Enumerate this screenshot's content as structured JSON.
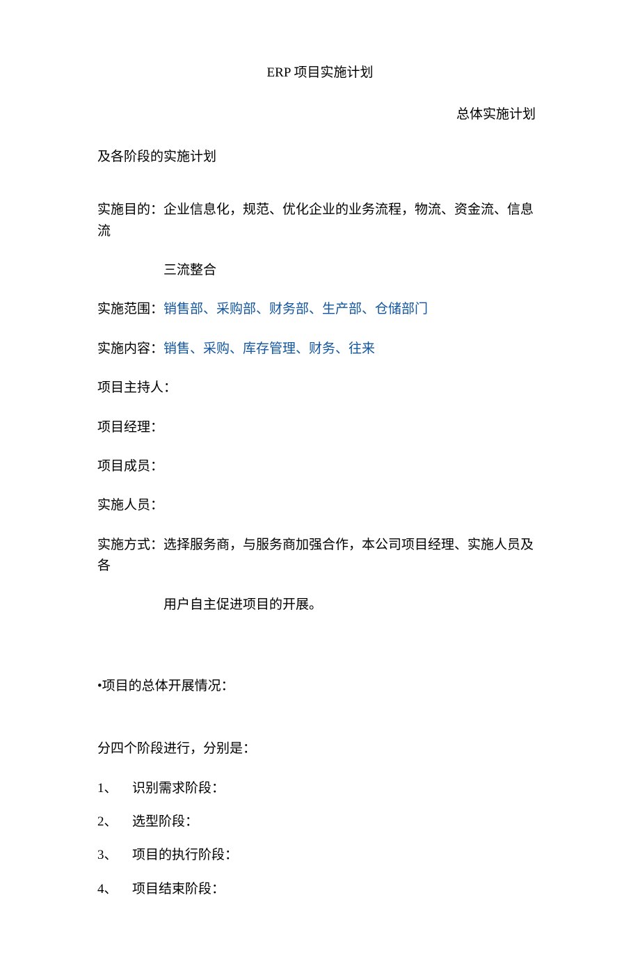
{
  "title": "ERP 项目实施计划",
  "subtitle": "总体实施计划",
  "line_sub2": "及各阶段的实施计划",
  "purpose_label": "实施目的：",
  "purpose_text": "企业信息化，规范、优化企业的业务流程，物流、资金流、信息流",
  "purpose_text2": "三流整合",
  "scope_label": "实施范围：",
  "scope_text": "销售部、采购部、财务部、生产部、仓储部门",
  "content_label": "实施内容：",
  "content_text": "销售、采购、库存管理、财务、往来",
  "host_label": "项目主持人：",
  "manager_label": "项目经理：",
  "members_label": "项目成员：",
  "staff_label": "实施人员：",
  "method_label": "实施方式：",
  "method_text": "选择服务商，与服务商加强合作，本公司项目经理、实施人员及各",
  "method_text2": "用户自主促进项目的开展。",
  "overall_label": "•项目的总体开展情况：",
  "phases_label": "分四个阶段进行，分别是：",
  "phases": [
    {
      "num": "1、",
      "label": "识别需求阶段："
    },
    {
      "num": "2、",
      "label": "选型阶段："
    },
    {
      "num": "3、",
      "label": "项目的执行阶段："
    },
    {
      "num": "4、",
      "label": "项目结束阶段："
    }
  ]
}
